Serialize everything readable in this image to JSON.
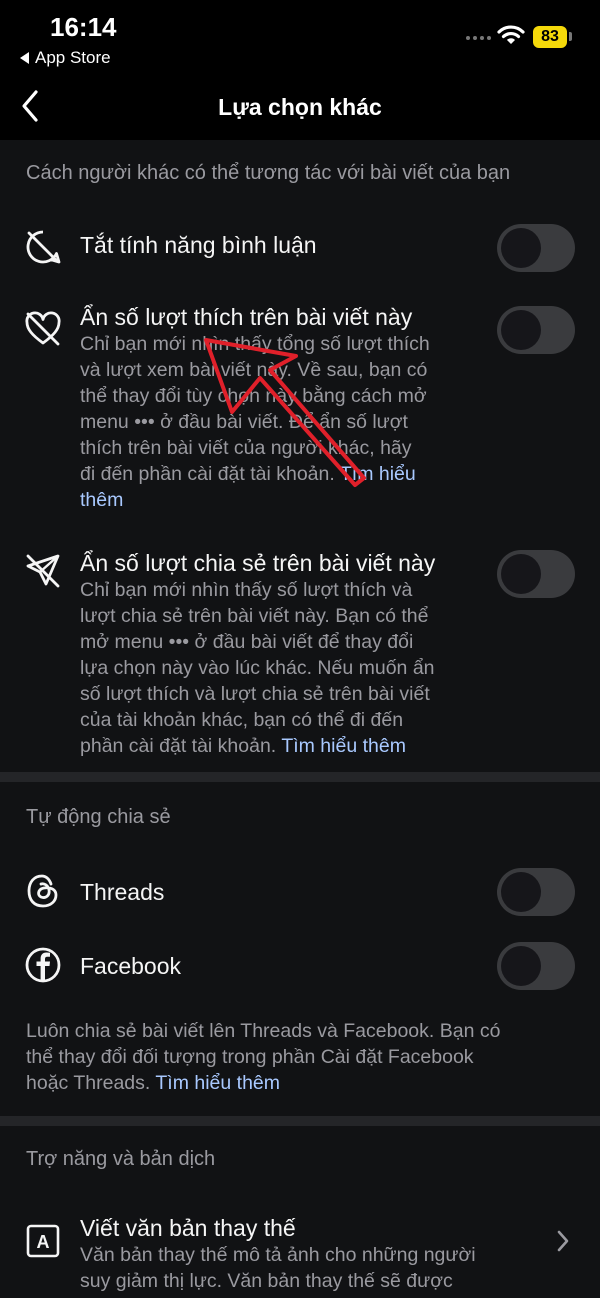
{
  "status_bar": {
    "time": "16:14",
    "back_app_label": "App Store",
    "battery": "83"
  },
  "nav": {
    "title": "Lựa chọn khác",
    "back_icon": "chevron-left-icon"
  },
  "interaction_section": {
    "header": "Cách người khác có thể tương tác với bài viết của bạn",
    "items": [
      {
        "icon": "comment-off-icon",
        "title": "Tắt tính năng bình luận",
        "enabled": false
      },
      {
        "icon": "heart-off-icon",
        "title": "Ẩn số lượt thích trên bài viết này",
        "desc_lines": [
          "Chỉ bạn mới nhìn thấy tổng số lượt thích",
          "và lượt xem bài viết này. Về sau, bạn có",
          "thể thay đổi tùy chọn này bằng cách mở",
          "menu ••• ở đầu bài viết. Để ẩn số lượt",
          "thích trên bài viết của người khác, hãy",
          "đi đến phần cài đặt tài khoản."
        ],
        "link_part1": "Tìm hiểu",
        "link_part2": "thêm",
        "enabled": false
      },
      {
        "icon": "share-off-icon",
        "title": "Ẩn số lượt chia sẻ trên bài viết này",
        "desc_lines": [
          "Chỉ bạn mới nhìn thấy số lượt thích và",
          "lượt chia sẻ trên bài viết này. Bạn có thể",
          "mở menu ••• ở đầu bài viết để thay đổi",
          "lựa chọn này vào lúc khác. Nếu muốn ẩn",
          "số lượt thích và lượt chia sẻ trên bài viết",
          "của tài khoản khác, bạn có thể đi đến",
          "phần cài đặt tài khoản."
        ],
        "link": "Tìm hiểu thêm",
        "enabled": false
      }
    ]
  },
  "autoshare_section": {
    "header": "Tự động chia sẻ",
    "items": [
      {
        "icon": "threads-icon",
        "title": "Threads",
        "enabled": false
      },
      {
        "icon": "facebook-icon",
        "title": "Facebook",
        "enabled": false
      }
    ],
    "info_lines": [
      "Luôn chia sẻ bài viết lên Threads và Facebook. Bạn có",
      "thể thay đổi đối tượng trong phần Cài đặt Facebook",
      "hoặc Threads."
    ],
    "info_link": "Tìm hiểu thêm"
  },
  "accessibility_section": {
    "header": "Trợ năng và bản dịch",
    "item": {
      "icon": "alt-text-icon",
      "icon_letter": "A",
      "title": "Viết văn bản thay thế",
      "desc_lines": [
        "Văn bản thay thế mô tả ảnh cho những người",
        "suy giảm thị lực. Văn bản thay thế sẽ được"
      ]
    }
  },
  "colors": {
    "background": "#111214",
    "annotation_arrow": "#e0202a",
    "link": "#a9c9ff",
    "battery": "#f5d90a"
  }
}
